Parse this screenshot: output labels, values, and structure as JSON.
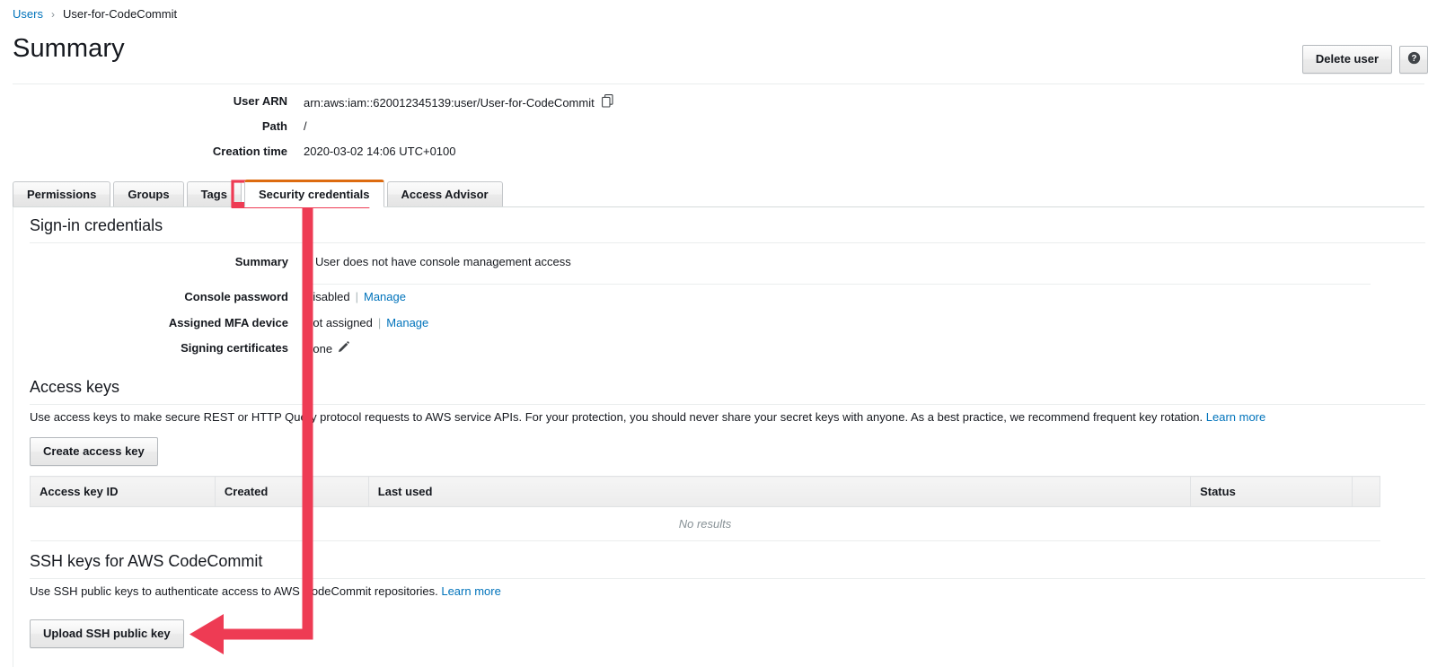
{
  "breadcrumb": {
    "parent": "Users",
    "separator": "›",
    "current": "User-for-CodeCommit"
  },
  "header": {
    "title": "Summary",
    "delete_button": "Delete user",
    "help_icon": "help-circle-icon"
  },
  "details": [
    {
      "label": "User ARN",
      "value": "arn:aws:iam::620012345139:user/User-for-CodeCommit",
      "icon": "copy-icon"
    },
    {
      "label": "Path",
      "value": "/",
      "icon": ""
    },
    {
      "label": "Creation time",
      "value": "2020-03-02 14:06 UTC+0100",
      "icon": ""
    }
  ],
  "tabs": [
    {
      "label": "Permissions",
      "active": false
    },
    {
      "label": "Groups",
      "active": false
    },
    {
      "label": "Tags",
      "active": false
    },
    {
      "label": "Security credentials",
      "active": true
    },
    {
      "label": "Access Advisor",
      "active": false
    }
  ],
  "signin": {
    "heading": "Sign-in credentials",
    "summary_label": "Summary",
    "summary_value": "User does not have console management access",
    "rows": [
      {
        "label": "Console password",
        "value": "Disabled",
        "action": "Manage",
        "icon": ""
      },
      {
        "label": "Assigned MFA device",
        "value": "Not assigned",
        "action": "Manage",
        "icon": ""
      },
      {
        "label": "Signing certificates",
        "value": "None",
        "action": "",
        "icon": "pencil-icon"
      }
    ]
  },
  "access_keys": {
    "heading": "Access keys",
    "description": "Use access keys to make secure REST or HTTP Query protocol requests to AWS service APIs. For your protection, you should never share your secret keys with anyone. As a best practice, we recommend frequent key rotation.",
    "learn_more": "Learn more",
    "create_button": "Create access key",
    "columns": [
      "Access key ID",
      "Created",
      "Last used",
      "Status",
      ""
    ],
    "rows": [],
    "empty_text": "No results"
  },
  "ssh_keys": {
    "heading": "SSH keys for AWS CodeCommit",
    "description": "Use SSH public keys to authenticate access to AWS CodeCommit repositories.",
    "learn_more": "Learn more",
    "upload_button": "Upload SSH public key"
  },
  "annotation": {
    "color": "#ee3b54",
    "highlight_target": "Security credentials",
    "points_to": "Upload SSH public key"
  },
  "colors": {
    "accent_orange": "#dd6b10",
    "link_blue": "#0073bb",
    "annotation_red": "#ee3b54",
    "text": "#16191f",
    "muted": "#879196"
  }
}
